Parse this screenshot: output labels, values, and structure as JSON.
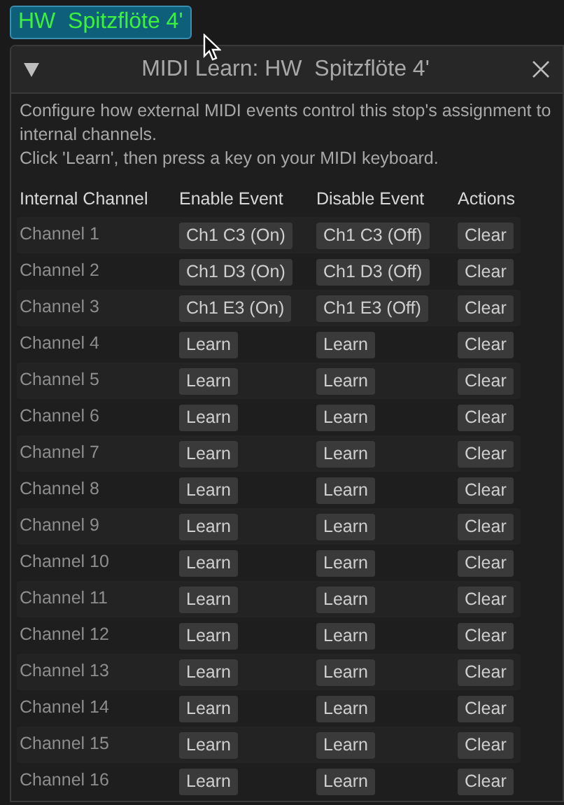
{
  "stop_button": {
    "label": "HW  Spitzflöte 4'",
    "selected": true
  },
  "dialog": {
    "title": "MIDI Learn: HW  Spitzflöte 4'",
    "description": [
      "Configure how external MIDI events control this stop's assignment to internal channels.",
      "Click 'Learn', then press a key on your MIDI keyboard."
    ]
  },
  "table": {
    "columns": [
      "Internal Channel",
      "Enable Event",
      "Disable Event",
      "Actions"
    ],
    "rows": [
      {
        "channel": "Channel 1",
        "enable": "Ch1 C3 (On)",
        "disable": "Ch1 C3 (Off)",
        "action": "Clear"
      },
      {
        "channel": "Channel 2",
        "enable": "Ch1 D3 (On)",
        "disable": "Ch1 D3 (Off)",
        "action": "Clear"
      },
      {
        "channel": "Channel 3",
        "enable": "Ch1 E3 (On)",
        "disable": "Ch1 E3 (Off)",
        "action": "Clear"
      },
      {
        "channel": "Channel 4",
        "enable": "Learn",
        "disable": "Learn",
        "action": "Clear"
      },
      {
        "channel": "Channel 5",
        "enable": "Learn",
        "disable": "Learn",
        "action": "Clear"
      },
      {
        "channel": "Channel 6",
        "enable": "Learn",
        "disable": "Learn",
        "action": "Clear"
      },
      {
        "channel": "Channel 7",
        "enable": "Learn",
        "disable": "Learn",
        "action": "Clear"
      },
      {
        "channel": "Channel 8",
        "enable": "Learn",
        "disable": "Learn",
        "action": "Clear"
      },
      {
        "channel": "Channel 9",
        "enable": "Learn",
        "disable": "Learn",
        "action": "Clear"
      },
      {
        "channel": "Channel 10",
        "enable": "Learn",
        "disable": "Learn",
        "action": "Clear"
      },
      {
        "channel": "Channel 11",
        "enable": "Learn",
        "disable": "Learn",
        "action": "Clear"
      },
      {
        "channel": "Channel 12",
        "enable": "Learn",
        "disable": "Learn",
        "action": "Clear"
      },
      {
        "channel": "Channel 13",
        "enable": "Learn",
        "disable": "Learn",
        "action": "Clear"
      },
      {
        "channel": "Channel 14",
        "enable": "Learn",
        "disable": "Learn",
        "action": "Clear"
      },
      {
        "channel": "Channel 15",
        "enable": "Learn",
        "disable": "Learn",
        "action": "Clear"
      },
      {
        "channel": "Channel 16",
        "enable": "Learn",
        "disable": "Learn",
        "action": "Clear"
      }
    ]
  }
}
